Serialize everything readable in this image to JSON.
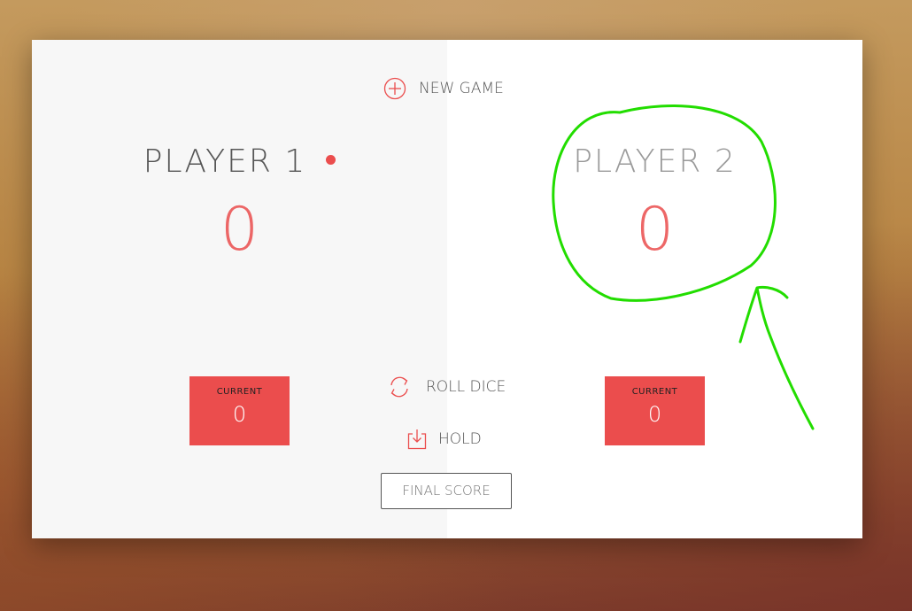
{
  "buttons": {
    "new_game": "NEW GAME",
    "roll_dice": "ROLL DICE",
    "hold": "HOLD",
    "final_score_placeholder": "FINAL SCORE"
  },
  "players": [
    {
      "name": "PLAYER 1",
      "score": "0",
      "current_label": "CURRENT",
      "current_score": "0",
      "active": true
    },
    {
      "name": "PLAYER 2",
      "score": "0",
      "current_label": "CURRENT",
      "current_score": "0",
      "active": false
    }
  ],
  "icons": {
    "new_game": "plus-circle-icon",
    "roll_dice": "refresh-icon",
    "hold": "download-icon",
    "active_player": "dot-icon"
  },
  "colors": {
    "accent": "#EB4D4D",
    "annotation": "#22DD00"
  }
}
